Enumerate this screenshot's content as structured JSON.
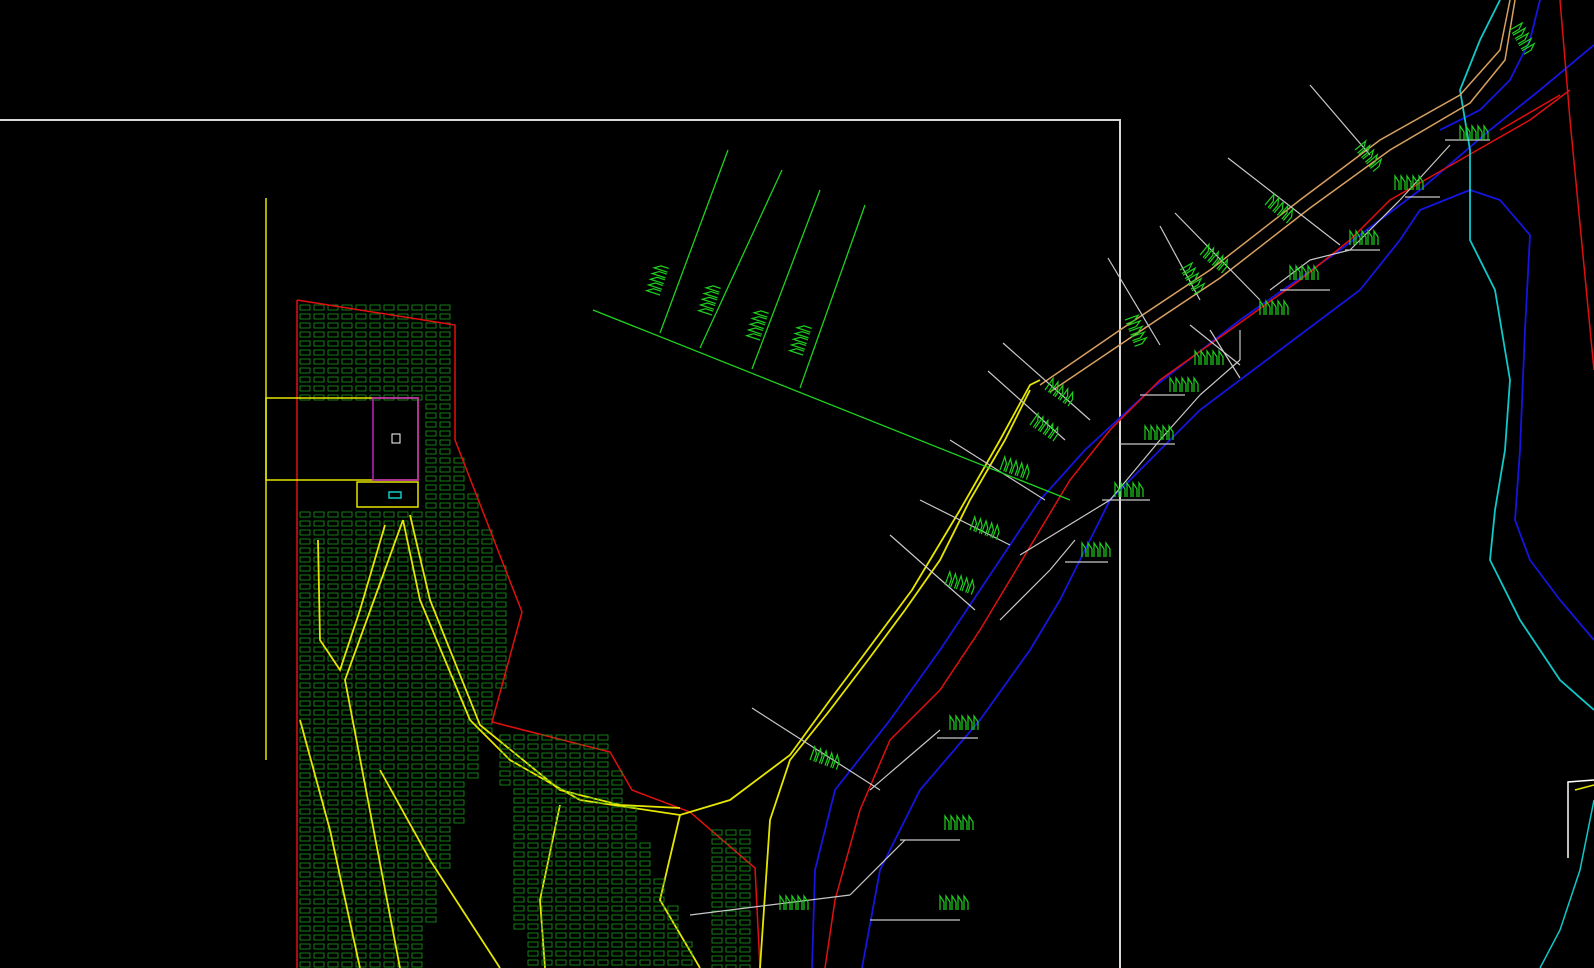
{
  "colors": {
    "background": "#000000",
    "frame": "#d8d8d8",
    "contour_green": "#1fd11f",
    "hatch_green": "#1a9a1a",
    "road_yellow": "#e6e600",
    "boundary_red": "#e01010",
    "channel_blue": "#1515e0",
    "river_cyan": "#10c8c8",
    "leader_grey": "#c8c8c8",
    "pipe_tan": "#d8a060",
    "block_magenta": "#c020c0"
  },
  "icons": {
    "viewport": "cad-drawing-canvas"
  }
}
